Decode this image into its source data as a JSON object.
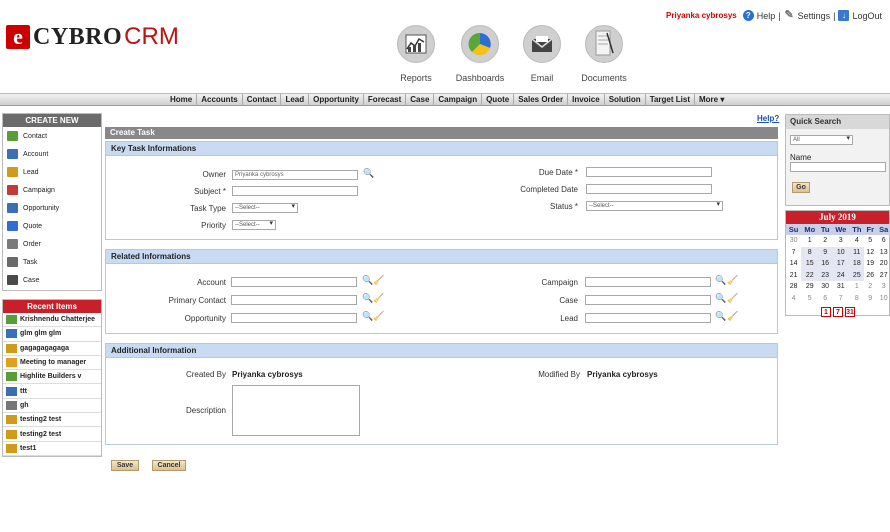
{
  "header": {
    "logo_mark": "e",
    "logo_text1": "CYBRO",
    "logo_text2": "CRM",
    "user": "Priyanka cybrosys",
    "help": "Help",
    "settings": "Settings",
    "logout": "LogOut",
    "sep": "|",
    "apps": [
      {
        "label": "Reports",
        "icon": "reports-chart-icon"
      },
      {
        "label": "Dashboards",
        "icon": "dashboards-pie-icon"
      },
      {
        "label": "Email",
        "icon": "email-envelope-icon"
      },
      {
        "label": "Documents",
        "icon": "documents-icon"
      }
    ]
  },
  "nav": [
    "Home",
    "Accounts",
    "Contact",
    "Lead",
    "Opportunity",
    "Forecast",
    "Case",
    "Campaign",
    "Quote",
    "Sales Order",
    "Invoice",
    "Solution",
    "Target List",
    "More ▾"
  ],
  "create_new": {
    "title": "CREATE NEW",
    "items": [
      {
        "label": "Contact",
        "color": "#5a9e3a"
      },
      {
        "label": "Account",
        "color": "#3d6fb6"
      },
      {
        "label": "Lead",
        "color": "#d09a1c"
      },
      {
        "label": "Campaign",
        "color": "#c43a3a"
      },
      {
        "label": "Opportunity",
        "color": "#3a6fb0"
      },
      {
        "label": "Quote",
        "color": "#2f6fd0"
      },
      {
        "label": "Order",
        "color": "#7a7a7a"
      },
      {
        "label": "Task",
        "color": "#6a6a6a"
      },
      {
        "label": "Case",
        "color": "#4a4a4a"
      }
    ]
  },
  "recent": {
    "title": "Recent Items",
    "items": [
      "Krishnendu Chatterjee",
      "glm glm glm",
      "gagagagagaga",
      "Meeting to manager",
      "Highlite Builders v",
      "ttt",
      "gh",
      "testing2 test",
      "testing2 test",
      "test1"
    ]
  },
  "main": {
    "help": "Help?",
    "title": "Create Task",
    "key": {
      "title": "Key Task Informations",
      "owner_label": "Owner",
      "owner_value": "Priyanka cybrosys",
      "subject_label": "Subject *",
      "tasktype_label": "Task Type",
      "tasktype_value": "--Select--",
      "priority_label": "Priority",
      "priority_value": "--Select--",
      "due_label": "Due Date *",
      "completed_label": "Completed Date",
      "status_label": "Status *",
      "status_value": "--Select--"
    },
    "related": {
      "title": "Related Informations",
      "account_label": "Account",
      "primary_label": "Primary Contact",
      "opportunity_label": "Opportunity",
      "campaign_label": "Campaign",
      "case_label": "Case",
      "lead_label": "Lead"
    },
    "additional": {
      "title": "Additional Information",
      "created_label": "Created By",
      "created_value": "Priyanka cybrosys",
      "modified_label": "Modified By",
      "modified_value": "Priyanka cybrosys",
      "description_label": "Description"
    },
    "save": "Save",
    "cancel": "Cancel"
  },
  "quick_search": {
    "title": "Quick Search",
    "select_value": "All",
    "name_label": "Name",
    "go": "Go"
  },
  "calendar": {
    "title": "July 2019",
    "days": [
      "Su",
      "Mo",
      "Tu",
      "We",
      "Th",
      "Fr",
      "Sa"
    ],
    "weeks": [
      [
        "30",
        "1",
        "2",
        "3",
        "4",
        "5",
        "6"
      ],
      [
        "7",
        "8",
        "9",
        "10",
        "11",
        "12",
        "13"
      ],
      [
        "14",
        "15",
        "16",
        "17",
        "18",
        "19",
        "20"
      ],
      [
        "21",
        "22",
        "23",
        "24",
        "25",
        "26",
        "27"
      ],
      [
        "28",
        "29",
        "30",
        "31",
        "1",
        "2",
        "3"
      ],
      [
        "4",
        "5",
        "6",
        "7",
        "8",
        "9",
        "10"
      ]
    ],
    "buttons": [
      "1",
      "7",
      "31"
    ]
  }
}
